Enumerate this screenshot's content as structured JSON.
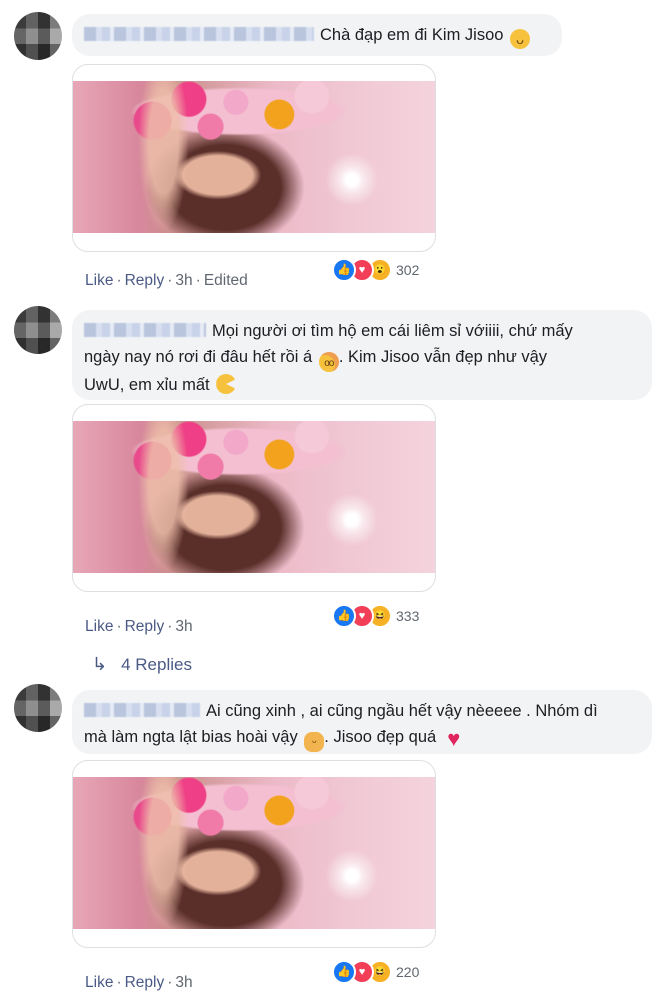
{
  "comments": [
    {
      "text_parts": [
        "Chà đạp em đi Kim Jisoo"
      ],
      "emoji_after": "tongue-emoji",
      "meta": {
        "like": "Like",
        "reply": "Reply",
        "time": "3h",
        "edited": "Edited"
      },
      "reactions": {
        "icons": [
          "like-reaction",
          "love-reaction",
          "wow-reaction"
        ],
        "count": "302"
      }
    },
    {
      "text_line1": "Mọi người ơi tìm hộ em cái liêm sỉ vớiiii, chứ mấy",
      "text_line2": "ngày nay nó rơi đi đâu hết rồi á",
      "text_line2b": ". Kim Jisoo vẫn đẹp như vậy",
      "text_line3": "UwU, em xỉu mất",
      "meta": {
        "like": "Like",
        "reply": "Reply",
        "time": "3h"
      },
      "reactions": {
        "icons": [
          "like-reaction",
          "love-reaction",
          "haha-reaction"
        ],
        "count": "333"
      },
      "replies_label": "4 Replies"
    },
    {
      "text_line1": "Ai cũng xinh , ai cũng ngầu hết vậy nèeeee . Nhóm dì",
      "text_line2a": "mà làm ngta lật bias hoài vậy",
      "text_line2b": ". Jisoo đẹp quá",
      "meta": {
        "like": "Like",
        "reply": "Reply",
        "time": "3h"
      },
      "reactions": {
        "icons": [
          "like-reaction",
          "love-reaction",
          "haha-reaction"
        ],
        "count": "220"
      }
    }
  ],
  "colors": {
    "link": "#4a5a85",
    "bubble": "#f2f3f5",
    "like": "#1877f2",
    "love": "#f33e58",
    "haha": "#f7b125"
  }
}
